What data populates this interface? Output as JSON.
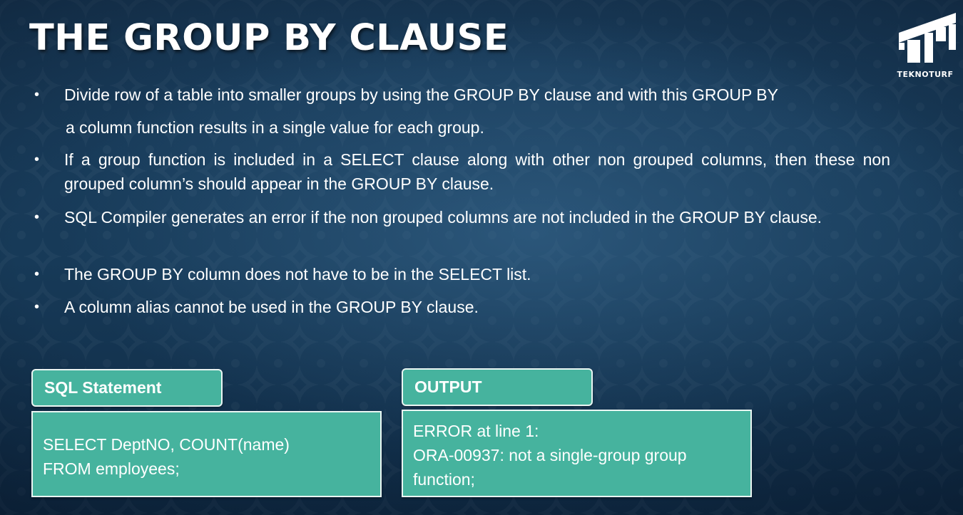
{
  "slide": {
    "title": "THE GROUP BY CLAUSE",
    "logo": {
      "icon": "teknoturf-logo-icon",
      "text": "TEKNOTURF"
    },
    "bullets": [
      {
        "line1": "Divide row of a table into smaller groups by using the GROUP BY clause and with this GROUP BY",
        "line2": "a column function results in a single value for each group."
      },
      {
        "text": "If a group function is included in a SELECT clause along with other non grouped columns, then these non grouped column’s should appear in the GROUP BY clause."
      },
      {
        "text": "SQL Compiler generates an error if the non grouped columns are not  included in the GROUP BY clause."
      },
      {
        "text": "The GROUP BY column does not have to be in the SELECT list."
      },
      {
        "text": "A column alias cannot be used in the GROUP BY clause."
      }
    ],
    "bullet_glyph": "•",
    "sql": {
      "label": "SQL Statement",
      "lines": [
        "SELECT DeptNO, COUNT(name)",
        "FROM employees;"
      ]
    },
    "output": {
      "label": "OUTPUT",
      "lines": [
        "ERROR at line 1:",
        "ORA-00937: not a single-group group",
        "function;"
      ]
    }
  },
  "colors": {
    "background": "#12304a",
    "accent": "#46b39e",
    "text": "#ffffff"
  }
}
